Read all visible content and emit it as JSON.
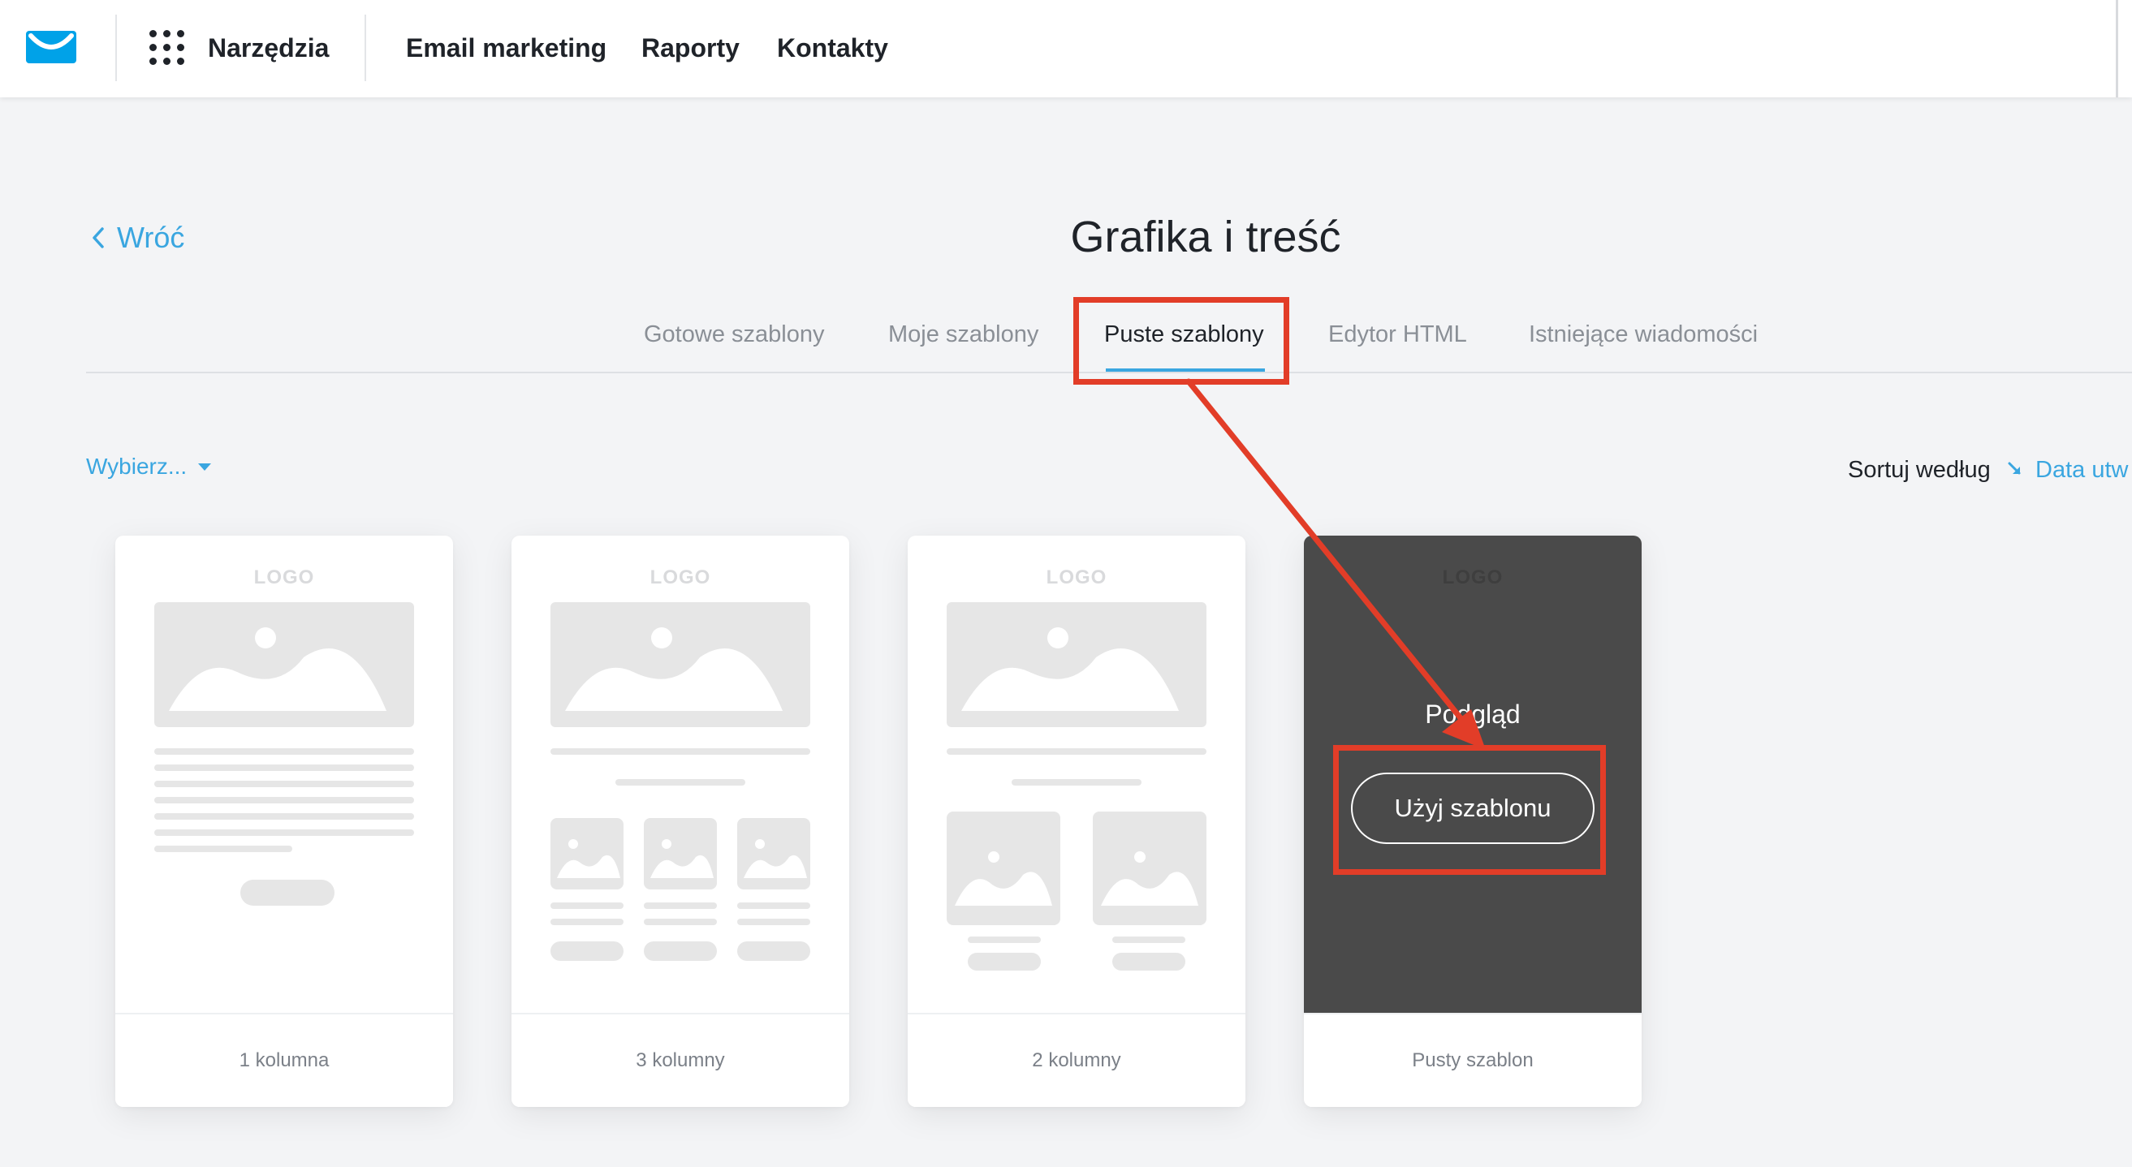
{
  "nav": {
    "tools_label": "Narzędzia",
    "items": [
      "Email marketing",
      "Raporty",
      "Kontakty"
    ]
  },
  "header": {
    "back_label": "Wróć",
    "title": "Grafika i treść"
  },
  "tabs": [
    {
      "label": "Gotowe szablony"
    },
    {
      "label": "Moje szablony"
    },
    {
      "label": "Puste szablony",
      "active": true
    },
    {
      "label": "Edytor HTML"
    },
    {
      "label": "Istniejące wiadomości"
    }
  ],
  "toolbar": {
    "select_label": "Wybierz...",
    "sort_label": "Sortuj według",
    "sort_value": "Data utw"
  },
  "cards": [
    {
      "logo": "LOGO",
      "label": "1 kolumna"
    },
    {
      "logo": "LOGO",
      "label": "3 kolumny"
    },
    {
      "logo": "LOGO",
      "label": "2 kolumny"
    },
    {
      "logo": "LOGO",
      "label": "Pusty szablon",
      "hover_preview": "Podgląd",
      "hover_action": "Użyj szablonu"
    }
  ],
  "colors": {
    "accent": "#3aa6e0",
    "annotation": "#e23d28",
    "dark_overlay": "#4a4a4a",
    "placeholder": "#e6e6e6"
  },
  "icons": {
    "brand": "envelope-logo-icon",
    "tools": "grid-dots-icon",
    "back": "chevron-left-icon",
    "dropdown": "caret-down-icon",
    "sort": "sort-arrow-icon"
  }
}
